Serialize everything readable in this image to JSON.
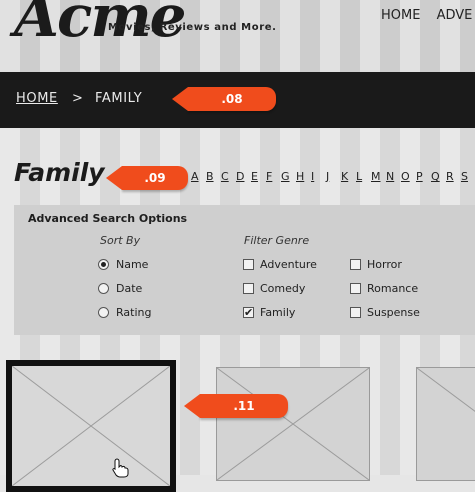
{
  "header": {
    "logo_text": "Acme",
    "tagline": "Movies, Reviews and More.",
    "nav": [
      "HOME",
      "ADVE"
    ]
  },
  "breadcrumb": {
    "home": "HOME",
    "separator": ">",
    "current": "FAMILY"
  },
  "annotations": {
    "tag_08": ".08",
    "tag_09": ".09",
    "tag_11": ".11"
  },
  "page": {
    "title": "Family",
    "letters": [
      "A",
      "B",
      "C",
      "D",
      "E",
      "F",
      "G",
      "H",
      "I",
      "J",
      "K",
      "L",
      "M",
      "N",
      "O",
      "P",
      "Q",
      "R",
      "S"
    ]
  },
  "search": {
    "title": "Advanced Search Options",
    "sort_by": {
      "label": "Sort By",
      "options": [
        {
          "label": "Name",
          "selected": true
        },
        {
          "label": "Date",
          "selected": false
        },
        {
          "label": "Rating",
          "selected": false
        }
      ]
    },
    "filter_genre": {
      "label": "Filter Genre",
      "options": [
        {
          "label": "Adventure",
          "checked": false
        },
        {
          "label": "Comedy",
          "checked": false
        },
        {
          "label": "Family",
          "checked": true
        },
        {
          "label": "Horror",
          "checked": false
        },
        {
          "label": "Romance",
          "checked": false
        },
        {
          "label": "Suspense",
          "checked": false
        }
      ]
    }
  },
  "colors": {
    "accent": "#f04c1c",
    "dark_bar": "#1a1a1a",
    "panel": "#cfcfcf"
  }
}
